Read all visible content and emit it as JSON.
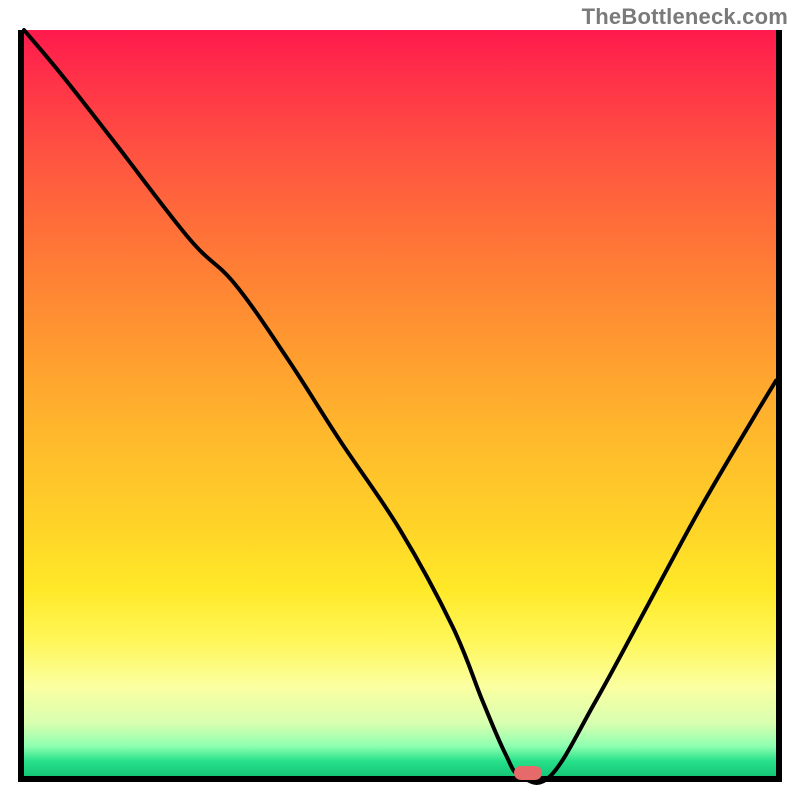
{
  "watermark": "TheBottleneck.com",
  "chart_data": {
    "type": "line",
    "title": "",
    "xlabel": "",
    "ylabel": "",
    "xlim": [
      0,
      100
    ],
    "ylim": [
      0,
      100
    ],
    "grid": false,
    "background": "red-yellow-green vertical gradient",
    "series": [
      {
        "name": "bottleneck-curve",
        "x": [
          0,
          5,
          12,
          22,
          28,
          35,
          42,
          50,
          57,
          61,
          64,
          66,
          70,
          76,
          83,
          90,
          97,
          100
        ],
        "values": [
          100,
          94,
          85,
          72,
          66,
          56,
          45,
          33,
          20,
          10,
          3,
          0,
          0,
          10,
          23,
          36,
          48,
          53
        ]
      }
    ],
    "marker": {
      "x": 67,
      "y": 0,
      "color": "#e76a6a"
    },
    "gradient_stops": [
      {
        "pos": 0,
        "color": "#ff1a4d"
      },
      {
        "pos": 7,
        "color": "#ff3348"
      },
      {
        "pos": 18,
        "color": "#ff5740"
      },
      {
        "pos": 30,
        "color": "#ff7936"
      },
      {
        "pos": 42,
        "color": "#ff9930"
      },
      {
        "pos": 54,
        "color": "#ffb82c"
      },
      {
        "pos": 66,
        "color": "#ffd228"
      },
      {
        "pos": 75,
        "color": "#ffe928"
      },
      {
        "pos": 82,
        "color": "#fff75a"
      },
      {
        "pos": 88,
        "color": "#fbffa0"
      },
      {
        "pos": 93,
        "color": "#d7ffb0"
      },
      {
        "pos": 96,
        "color": "#8effb0"
      },
      {
        "pos": 98,
        "color": "#28e08a"
      },
      {
        "pos": 100,
        "color": "#14c777"
      }
    ]
  }
}
